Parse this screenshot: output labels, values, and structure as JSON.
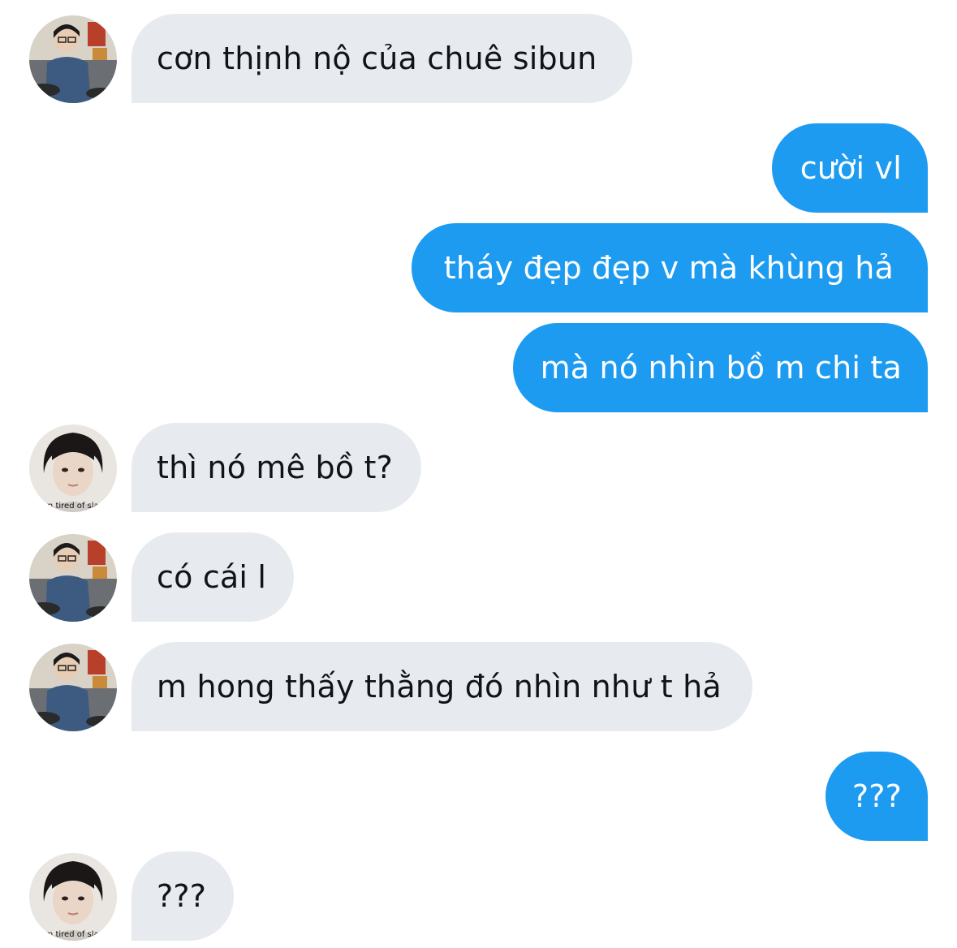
{
  "conversation": {
    "messages": [
      {
        "side": "in",
        "text": "cơn thịnh nộ của chuê sibun",
        "avatar": "drummer-photo-avatar"
      },
      {
        "side": "out",
        "text": "cười vl"
      },
      {
        "side": "out",
        "text": "tháy đẹp đẹp v mà khùng hả"
      },
      {
        "side": "out",
        "text": "mà nó nhìn bồ m chi ta"
      },
      {
        "side": "in",
        "text": "thì nó mê bồ t?",
        "avatar": "portrait-photo-avatar"
      },
      {
        "side": "in",
        "text": "có cái l",
        "avatar": "drummer-photo-avatar"
      },
      {
        "side": "in",
        "text": "m hong thấy thằng đó nhìn như t hả",
        "avatar": "drummer-photo-avatar"
      },
      {
        "side": "out",
        "text": "???"
      },
      {
        "side": "in",
        "text": "???",
        "avatar": "portrait-photo-avatar"
      }
    ],
    "avatar_watermark": "i'm tired of slaving"
  },
  "colors": {
    "incoming_bubble": "#e7ebef",
    "incoming_text": "#0f1419",
    "outgoing_bubble": "#1d9bf0",
    "outgoing_text": "#ffffff",
    "background": "#ffffff"
  }
}
